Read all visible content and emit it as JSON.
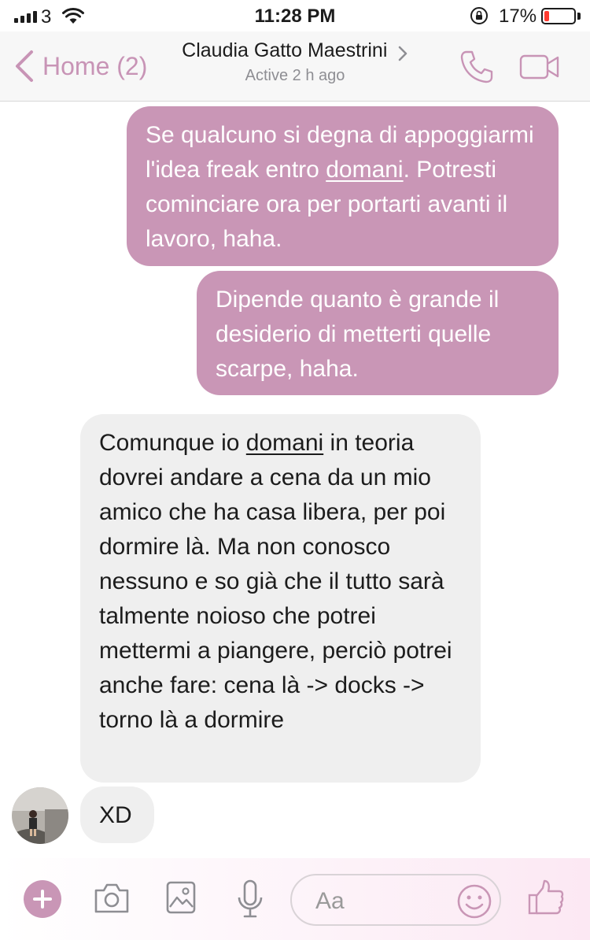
{
  "status_bar": {
    "carrier": "3",
    "time": "11:28 PM",
    "battery_percent": "17%",
    "battery_level": 0.17
  },
  "header": {
    "back_label": "Home (2)",
    "contact_name": "Claudia Gatto Maestrini",
    "contact_status": "Active 2 h ago"
  },
  "messages": [
    {
      "direction": "sent",
      "text_before": "Se qualcuno si degna di appoggiarmi l'idea freak entro ",
      "underlined": "domani",
      "text_after": ". Potresti cominciare ora per portarti avanti il lavoro, haha."
    },
    {
      "direction": "sent",
      "text": "Dipende quanto è grande il desiderio di metterti quelle scarpe, haha."
    },
    {
      "direction": "received",
      "text_before": "Comunque io ",
      "underlined": "domani",
      "text_after": " in teoria dovrei andare a cena da un mio amico che ha casa libera, per poi dormire là. Ma non conosco nessuno e so già che il tutto sarà talmente noioso che potrei mettermi a piangere, perciò potrei anche fare: cena là -> docks -> torno là a dormire"
    },
    {
      "direction": "received",
      "text": "XD"
    }
  ],
  "composer": {
    "placeholder": "Aa"
  },
  "icons": {
    "back": "chevron-left-icon",
    "phone": "phone-icon",
    "video": "video-camera-icon",
    "plus": "plus-icon",
    "camera": "camera-icon",
    "gallery": "gallery-icon",
    "mic": "microphone-icon",
    "emoji": "smiley-icon",
    "like": "thumbs-up-icon"
  },
  "colors": {
    "accent": "#c996b6",
    "sent_bubble": "#c996b6",
    "received_bubble": "#efefef",
    "battery_low": "#ff3b30"
  }
}
